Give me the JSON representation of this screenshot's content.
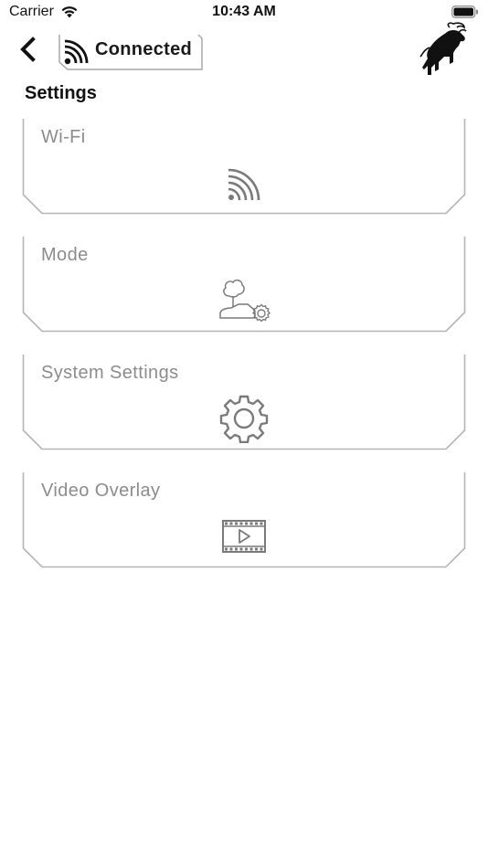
{
  "status_bar": {
    "carrier": "Carrier",
    "time": "10:43 AM"
  },
  "nav": {
    "connection_label": "Connected"
  },
  "page": {
    "title": "Settings"
  },
  "cards": [
    {
      "label": "Wi-Fi",
      "icon": "wifi-icon"
    },
    {
      "label": "Mode",
      "icon": "mode-icon"
    },
    {
      "label": "System Settings",
      "icon": "gear-icon"
    },
    {
      "label": "Video Overlay",
      "icon": "film-icon"
    }
  ],
  "colors": {
    "card_text": "#8c8c8c",
    "card_border": "#b5b5b5",
    "icon_gray": "#7a7a7a",
    "text_dark": "#111111"
  }
}
